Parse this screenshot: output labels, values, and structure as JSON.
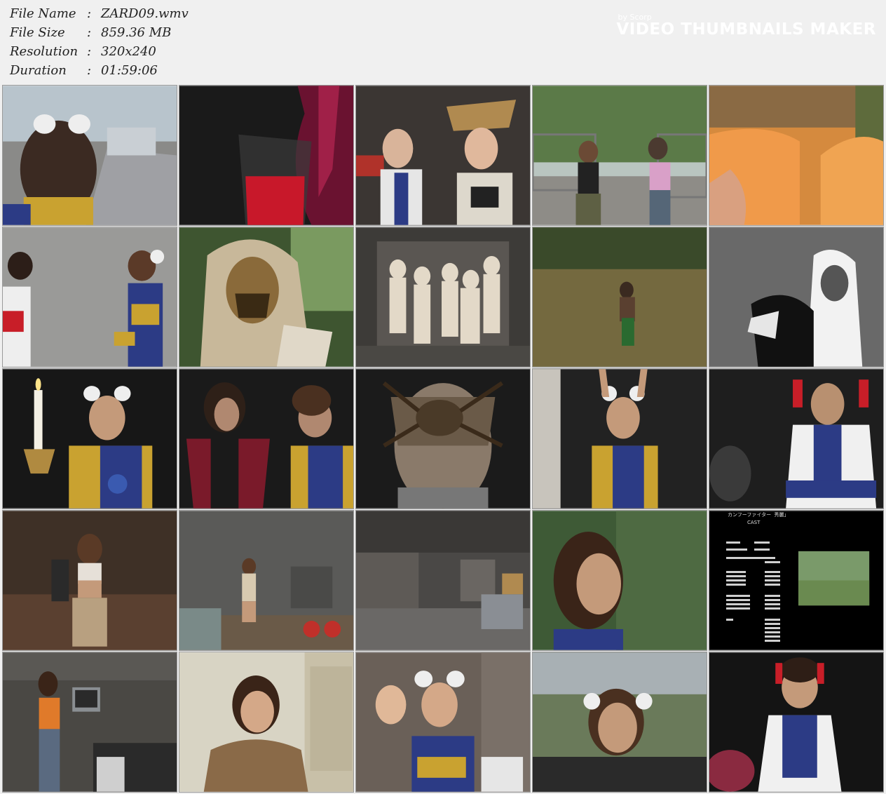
{
  "file_info": {
    "name_label": "File Name",
    "name_value": "ZARD09.wmv",
    "size_label": "File Size",
    "size_value": "859.36 MB",
    "resolution_label": "Resolution",
    "resolution_value": "320x240",
    "duration_label": "Duration",
    "duration_value": "01:59:06",
    "separator": ":"
  },
  "watermark": {
    "by": "by Scorp",
    "brand": "VIDEO THUMBNAILS MAKER"
  },
  "credits": {
    "heading": "カンフーファイター  秀麗」",
    "cast": "CAST"
  }
}
